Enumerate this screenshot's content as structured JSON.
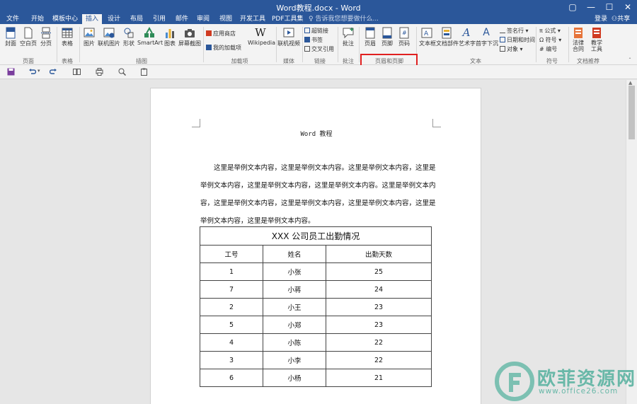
{
  "window": {
    "title": "Word教程.docx - Word",
    "controls": [
      "▢",
      "—",
      "☐",
      "✕"
    ]
  },
  "menu": {
    "tabs": [
      "文件",
      "开始",
      "模板中心",
      "插入",
      "设计",
      "布局",
      "引用",
      "邮件",
      "审阅",
      "视图",
      "开发工具",
      "PDF工具集"
    ],
    "active_tab": "插入",
    "tell_me": "告诉我您想要做什么...",
    "login": "登录",
    "share": "共享"
  },
  "ribbon": {
    "pages": {
      "cover": "封面",
      "blank": "空白页",
      "break": "分页",
      "label": "页面"
    },
    "tables": {
      "table": "表格",
      "label": "表格"
    },
    "illustrations": {
      "picture": "图片",
      "online_picture": "联机图片",
      "shapes": "形状",
      "smartart": "SmartArt",
      "chart": "图表",
      "screenshot": "屏幕截图",
      "label": "插图"
    },
    "addins": {
      "store": "应用商店",
      "my_addins": "我的加载项",
      "wikipedia": "Wikipedia",
      "label": "加载项"
    },
    "media": {
      "online_video": "联机视频",
      "label": "媒体"
    },
    "links": {
      "hyperlink": "超链接",
      "bookmark": "书签",
      "crossref": "交叉引用",
      "label": "链接"
    },
    "comments": {
      "comment": "批注",
      "label": "批注"
    },
    "header_footer": {
      "header": "页眉",
      "footer": "页脚",
      "page_number": "页码",
      "label": "页眉和页脚"
    },
    "text": {
      "textbox": "文本框",
      "quickparts": "文档部件",
      "wordart": "艺术字",
      "dropcap": "首字下沉",
      "signature": "签名行",
      "datetime": "日期和时间",
      "object": "对象",
      "label": "文本"
    },
    "symbols": {
      "equation": "公式",
      "symbol": "符号",
      "number": "编号",
      "label": "符号"
    },
    "doc_rec": {
      "legal": "法律合同",
      "teaching": "教学工具",
      "label": "文档推荐"
    }
  },
  "document": {
    "header": "Word 教程",
    "paragraph_lines": [
      "这里是举例文本内容，这里是举例文本内容。这里是举例文本内容，这里是",
      "举例文本内容，这里是举例文本内容，这里是举例文本内容。这里是举例文本内",
      "容，这里是举例文本内容，这里是举例文本内容，这里是举例文本内容，这里是",
      "举例文本内容，这里是举例文本内容。"
    ],
    "table": {
      "caption": "XXX 公司员工出勤情况",
      "headers": [
        "工号",
        "姓名",
        "出勤天数"
      ],
      "rows": [
        [
          "1",
          "小张",
          "25"
        ],
        [
          "7",
          "小蒋",
          "24"
        ],
        [
          "2",
          "小王",
          "23"
        ],
        [
          "5",
          "小郑",
          "23"
        ],
        [
          "4",
          "小陈",
          "22"
        ],
        [
          "3",
          "小李",
          "22"
        ],
        [
          "6",
          "小杨",
          "21"
        ]
      ]
    }
  },
  "watermark": {
    "name": "欧菲资源网",
    "url": "www.office26.com"
  },
  "colors": {
    "accent": "#2b579a",
    "highlight": "#e02020",
    "watermark": "#69b8a8"
  }
}
